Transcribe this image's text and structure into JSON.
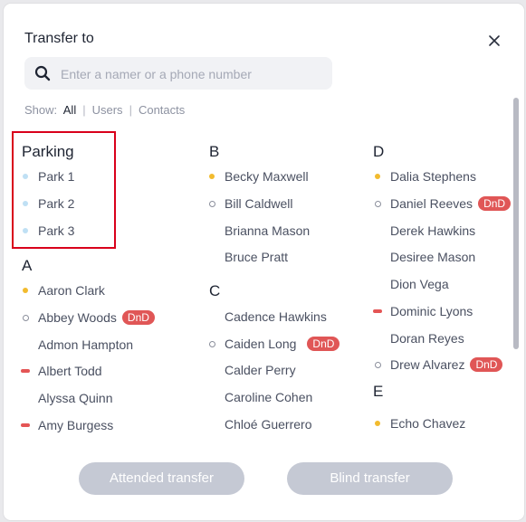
{
  "dialog": {
    "title": "Transfer to",
    "close_icon": "close-icon"
  },
  "search": {
    "icon": "search-icon",
    "placeholder": "Enter a namer or a phone number",
    "value": ""
  },
  "filters": {
    "label": "Show:",
    "options": [
      "All",
      "Users",
      "Contacts"
    ],
    "selected": "All"
  },
  "columns": {
    "col1": {
      "parking_head": "Parking",
      "parking": [
        "Park 1",
        "Park 2",
        "Park 3"
      ],
      "a_head": "A",
      "a_items": [
        {
          "name": "Aaron Clark",
          "status": "away",
          "badge": ""
        },
        {
          "name": "Abbey Woods",
          "status": "offline",
          "badge": "DnD"
        },
        {
          "name": "Admon Hampton",
          "status": "none",
          "badge": ""
        },
        {
          "name": "Albert Todd",
          "status": "busy",
          "badge": ""
        },
        {
          "name": "Alyssa Quinn",
          "status": "none",
          "badge": ""
        },
        {
          "name": "Amy Burgess",
          "status": "busy",
          "badge": ""
        }
      ]
    },
    "col2": {
      "b_head": "B",
      "b_items": [
        {
          "name": "Becky Maxwell",
          "status": "away",
          "badge": ""
        },
        {
          "name": "Bill Caldwell",
          "status": "offline",
          "badge": ""
        },
        {
          "name": "Brianna Mason",
          "status": "none",
          "badge": ""
        },
        {
          "name": "Bruce Pratt",
          "status": "none",
          "badge": ""
        }
      ],
      "c_head": "C",
      "c_items": [
        {
          "name": "Cadence Hawkins",
          "status": "none",
          "badge": ""
        },
        {
          "name": "Caiden Long",
          "status": "offline",
          "badge": "DnD"
        },
        {
          "name": "Calder Perry",
          "status": "none",
          "badge": ""
        },
        {
          "name": "Caroline Cohen",
          "status": "none",
          "badge": ""
        },
        {
          "name": "Chloé Guerrero",
          "status": "none",
          "badge": ""
        }
      ]
    },
    "col3": {
      "d_head": "D",
      "d_items": [
        {
          "name": "Dalia Stephens",
          "status": "away",
          "badge": ""
        },
        {
          "name": "Daniel Reeves",
          "status": "offline",
          "badge": "DnD"
        },
        {
          "name": "Derek Hawkins",
          "status": "none",
          "badge": ""
        },
        {
          "name": "Desiree Mason",
          "status": "none",
          "badge": ""
        },
        {
          "name": "Dion Vega",
          "status": "none",
          "badge": ""
        },
        {
          "name": "Dominic Lyons",
          "status": "busy",
          "badge": ""
        },
        {
          "name": "Doran Reyes",
          "status": "none",
          "badge": ""
        },
        {
          "name": "Drew Alvarez",
          "status": "offline",
          "badge": "DnD"
        }
      ],
      "e_head": "E",
      "e_items": [
        {
          "name": "Echo Chavez",
          "status": "away",
          "badge": ""
        }
      ]
    }
  },
  "buttons": {
    "attended": "Attended transfer",
    "blind": "Blind transfer"
  },
  "colors": {
    "highlight_border": "#d9001b",
    "dnd_badge": "#e05656",
    "away_dot": "#f2bb2e",
    "busy_dash": "#e45555",
    "parking_dot": "#bfe0f4",
    "button_disabled": "#c5c9d4"
  }
}
